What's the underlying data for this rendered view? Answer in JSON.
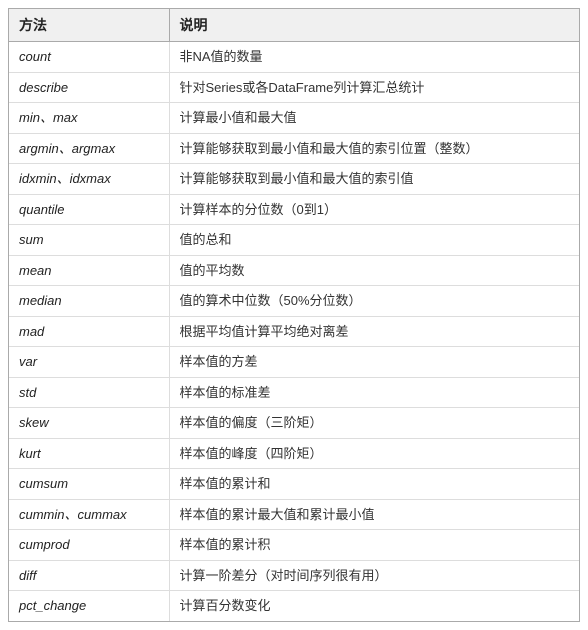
{
  "table": {
    "headers": [
      "方法",
      "说明"
    ],
    "rows": [
      {
        "method": "count",
        "description": "非NA值的数量"
      },
      {
        "method": "describe",
        "description": "针对Series或各DataFrame列计算汇总统计"
      },
      {
        "method": "min、max",
        "description": "计算最小值和最大值"
      },
      {
        "method": "argmin、argmax",
        "description": "计算能够获取到最小值和最大值的索引位置（整数）"
      },
      {
        "method": "idxmin、idxmax",
        "description": "计算能够获取到最小值和最大值的索引值"
      },
      {
        "method": "quantile",
        "description": "计算样本的分位数（0到1）"
      },
      {
        "method": "sum",
        "description": "值的总和"
      },
      {
        "method": "mean",
        "description": "值的平均数"
      },
      {
        "method": "median",
        "description": "值的算术中位数（50%分位数）"
      },
      {
        "method": "mad",
        "description": "根据平均值计算平均绝对离差"
      },
      {
        "method": "var",
        "description": "样本值的方差"
      },
      {
        "method": "std",
        "description": "样本值的标准差"
      },
      {
        "method": "skew",
        "description": "样本值的偏度（三阶矩）"
      },
      {
        "method": "kurt",
        "description": "样本值的峰度（四阶矩）"
      },
      {
        "method": "cumsum",
        "description": "样本值的累计和"
      },
      {
        "method": "cummin、cummax",
        "description": "样本值的累计最大值和累计最小值"
      },
      {
        "method": "cumprod",
        "description": "样本值的累计积"
      },
      {
        "method": "diff",
        "description": "计算一阶差分（对时间序列很有用）"
      },
      {
        "method": "pct_change",
        "description": "计算百分数变化"
      }
    ]
  }
}
